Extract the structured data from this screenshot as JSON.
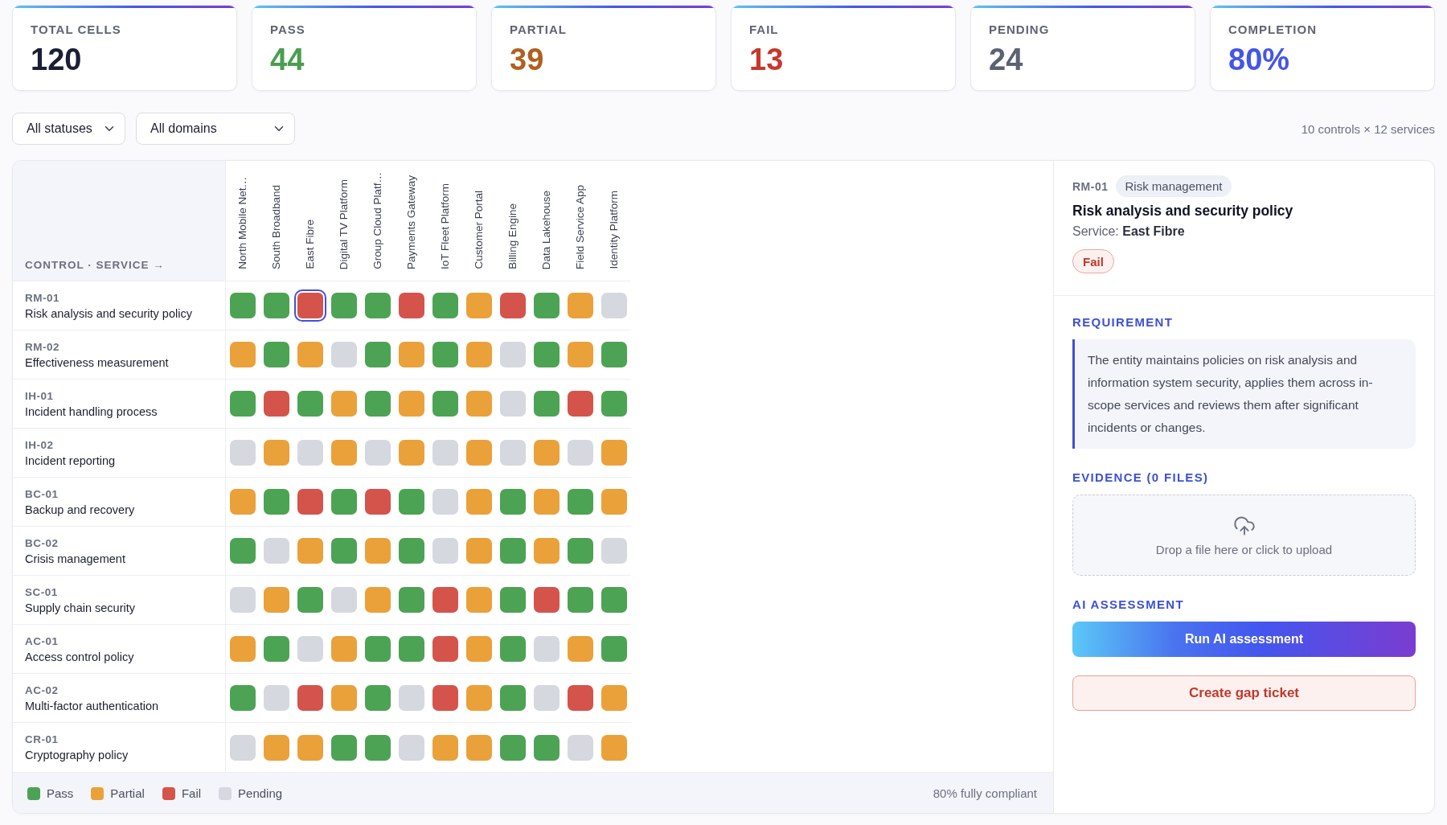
{
  "stats": [
    {
      "label": "TOTAL CELLS",
      "value": "120",
      "color": "#1b1e34"
    },
    {
      "label": "PASS",
      "value": "44",
      "color": "#4a9e4f"
    },
    {
      "label": "PARTIAL",
      "value": "39",
      "color": "#b0601f"
    },
    {
      "label": "FAIL",
      "value": "13",
      "color": "#c8372d"
    },
    {
      "label": "PENDING",
      "value": "24",
      "color": "#5d6271"
    },
    {
      "label": "COMPLETION",
      "value": "80%",
      "color": "#4456e6"
    }
  ],
  "filters": [
    {
      "value": "All statuses"
    },
    {
      "value": "All domains"
    }
  ],
  "summary": "10 controls × 12 services",
  "matrix": {
    "corner_label": "CONTROL · SERVICE →",
    "columns": [
      "North Mobile Net…",
      "South Broadband",
      "East Fibre",
      "Digital TV Platform",
      "Group Cloud Platf…",
      "Payments Gateway",
      "IoT Fleet Platform",
      "Customer Portal",
      "Billing Engine",
      "Data Lakehouse",
      "Field Service App",
      "Identity Platform"
    ],
    "rows": [
      {
        "code": "RM-01",
        "name": "Risk analysis and security policy",
        "cells": [
          {
            "color": "#4ca354",
            "selected": false
          },
          {
            "color": "#4ca354",
            "selected": false
          },
          {
            "color": "#d4544c",
            "selected": true
          },
          {
            "color": "#4ca354",
            "selected": false
          },
          {
            "color": "#4ca354",
            "selected": false
          },
          {
            "color": "#d4544c",
            "selected": false
          },
          {
            "color": "#4ca354",
            "selected": false
          },
          {
            "color": "#eaa13a",
            "selected": false
          },
          {
            "color": "#d4544c",
            "selected": false
          },
          {
            "color": "#4ca354",
            "selected": false
          },
          {
            "color": "#eaa13a",
            "selected": false
          },
          {
            "color": "#d6d8df",
            "selected": false
          }
        ]
      },
      {
        "code": "RM-02",
        "name": "Effectiveness measurement",
        "cells": [
          {
            "color": "#eaa13a",
            "selected": false
          },
          {
            "color": "#4ca354",
            "selected": false
          },
          {
            "color": "#eaa13a",
            "selected": false
          },
          {
            "color": "#d6d8df",
            "selected": false
          },
          {
            "color": "#4ca354",
            "selected": false
          },
          {
            "color": "#eaa13a",
            "selected": false
          },
          {
            "color": "#4ca354",
            "selected": false
          },
          {
            "color": "#eaa13a",
            "selected": false
          },
          {
            "color": "#d6d8df",
            "selected": false
          },
          {
            "color": "#4ca354",
            "selected": false
          },
          {
            "color": "#eaa13a",
            "selected": false
          },
          {
            "color": "#4ca354",
            "selected": false
          }
        ]
      },
      {
        "code": "IH-01",
        "name": "Incident handling process",
        "cells": [
          {
            "color": "#4ca354",
            "selected": false
          },
          {
            "color": "#d4544c",
            "selected": false
          },
          {
            "color": "#4ca354",
            "selected": false
          },
          {
            "color": "#eaa13a",
            "selected": false
          },
          {
            "color": "#4ca354",
            "selected": false
          },
          {
            "color": "#eaa13a",
            "selected": false
          },
          {
            "color": "#4ca354",
            "selected": false
          },
          {
            "color": "#eaa13a",
            "selected": false
          },
          {
            "color": "#d6d8df",
            "selected": false
          },
          {
            "color": "#4ca354",
            "selected": false
          },
          {
            "color": "#d4544c",
            "selected": false
          },
          {
            "color": "#4ca354",
            "selected": false
          }
        ]
      },
      {
        "code": "IH-02",
        "name": "Incident reporting",
        "cells": [
          {
            "color": "#d6d8df",
            "selected": false
          },
          {
            "color": "#eaa13a",
            "selected": false
          },
          {
            "color": "#d6d8df",
            "selected": false
          },
          {
            "color": "#eaa13a",
            "selected": false
          },
          {
            "color": "#d6d8df",
            "selected": false
          },
          {
            "color": "#eaa13a",
            "selected": false
          },
          {
            "color": "#d6d8df",
            "selected": false
          },
          {
            "color": "#eaa13a",
            "selected": false
          },
          {
            "color": "#d6d8df",
            "selected": false
          },
          {
            "color": "#eaa13a",
            "selected": false
          },
          {
            "color": "#d6d8df",
            "selected": false
          },
          {
            "color": "#eaa13a",
            "selected": false
          }
        ]
      },
      {
        "code": "BC-01",
        "name": "Backup and recovery",
        "cells": [
          {
            "color": "#eaa13a",
            "selected": false
          },
          {
            "color": "#4ca354",
            "selected": false
          },
          {
            "color": "#d4544c",
            "selected": false
          },
          {
            "color": "#4ca354",
            "selected": false
          },
          {
            "color": "#d4544c",
            "selected": false
          },
          {
            "color": "#4ca354",
            "selected": false
          },
          {
            "color": "#d6d8df",
            "selected": false
          },
          {
            "color": "#eaa13a",
            "selected": false
          },
          {
            "color": "#4ca354",
            "selected": false
          },
          {
            "color": "#eaa13a",
            "selected": false
          },
          {
            "color": "#4ca354",
            "selected": false
          },
          {
            "color": "#eaa13a",
            "selected": false
          }
        ]
      },
      {
        "code": "BC-02",
        "name": "Crisis management",
        "cells": [
          {
            "color": "#4ca354",
            "selected": false
          },
          {
            "color": "#d6d8df",
            "selected": false
          },
          {
            "color": "#eaa13a",
            "selected": false
          },
          {
            "color": "#4ca354",
            "selected": false
          },
          {
            "color": "#eaa13a",
            "selected": false
          },
          {
            "color": "#4ca354",
            "selected": false
          },
          {
            "color": "#d6d8df",
            "selected": false
          },
          {
            "color": "#eaa13a",
            "selected": false
          },
          {
            "color": "#4ca354",
            "selected": false
          },
          {
            "color": "#eaa13a",
            "selected": false
          },
          {
            "color": "#4ca354",
            "selected": false
          },
          {
            "color": "#d6d8df",
            "selected": false
          }
        ]
      },
      {
        "code": "SC-01",
        "name": "Supply chain security",
        "cells": [
          {
            "color": "#d6d8df",
            "selected": false
          },
          {
            "color": "#eaa13a",
            "selected": false
          },
          {
            "color": "#4ca354",
            "selected": false
          },
          {
            "color": "#d6d8df",
            "selected": false
          },
          {
            "color": "#eaa13a",
            "selected": false
          },
          {
            "color": "#4ca354",
            "selected": false
          },
          {
            "color": "#d4544c",
            "selected": false
          },
          {
            "color": "#eaa13a",
            "selected": false
          },
          {
            "color": "#4ca354",
            "selected": false
          },
          {
            "color": "#d4544c",
            "selected": false
          },
          {
            "color": "#4ca354",
            "selected": false
          },
          {
            "color": "#4ca354",
            "selected": false
          }
        ]
      },
      {
        "code": "AC-01",
        "name": "Access control policy",
        "cells": [
          {
            "color": "#eaa13a",
            "selected": false
          },
          {
            "color": "#4ca354",
            "selected": false
          },
          {
            "color": "#d6d8df",
            "selected": false
          },
          {
            "color": "#eaa13a",
            "selected": false
          },
          {
            "color": "#4ca354",
            "selected": false
          },
          {
            "color": "#4ca354",
            "selected": false
          },
          {
            "color": "#d4544c",
            "selected": false
          },
          {
            "color": "#eaa13a",
            "selected": false
          },
          {
            "color": "#4ca354",
            "selected": false
          },
          {
            "color": "#d6d8df",
            "selected": false
          },
          {
            "color": "#eaa13a",
            "selected": false
          },
          {
            "color": "#4ca354",
            "selected": false
          }
        ]
      },
      {
        "code": "AC-02",
        "name": "Multi-factor authentication",
        "cells": [
          {
            "color": "#4ca354",
            "selected": false
          },
          {
            "color": "#d6d8df",
            "selected": false
          },
          {
            "color": "#d4544c",
            "selected": false
          },
          {
            "color": "#eaa13a",
            "selected": false
          },
          {
            "color": "#4ca354",
            "selected": false
          },
          {
            "color": "#d6d8df",
            "selected": false
          },
          {
            "color": "#d4544c",
            "selected": false
          },
          {
            "color": "#eaa13a",
            "selected": false
          },
          {
            "color": "#4ca354",
            "selected": false
          },
          {
            "color": "#d6d8df",
            "selected": false
          },
          {
            "color": "#d4544c",
            "selected": false
          },
          {
            "color": "#eaa13a",
            "selected": false
          }
        ]
      },
      {
        "code": "CR-01",
        "name": "Cryptography policy",
        "cells": [
          {
            "color": "#d6d8df",
            "selected": false
          },
          {
            "color": "#eaa13a",
            "selected": false
          },
          {
            "color": "#eaa13a",
            "selected": false
          },
          {
            "color": "#4ca354",
            "selected": false
          },
          {
            "color": "#4ca354",
            "selected": false
          },
          {
            "color": "#d6d8df",
            "selected": false
          },
          {
            "color": "#eaa13a",
            "selected": false
          },
          {
            "color": "#eaa13a",
            "selected": false
          },
          {
            "color": "#4ca354",
            "selected": false
          },
          {
            "color": "#4ca354",
            "selected": false
          },
          {
            "color": "#d6d8df",
            "selected": false
          },
          {
            "color": "#eaa13a",
            "selected": false
          }
        ]
      }
    ]
  },
  "legend": {
    "items": [
      {
        "label": "Pass",
        "color": "#4ca354"
      },
      {
        "label": "Partial",
        "color": "#eaa13a"
      },
      {
        "label": "Fail",
        "color": "#d4544c"
      },
      {
        "label": "Pending",
        "color": "#d6d8df"
      }
    ],
    "summary": "80% fully compliant"
  },
  "detail": {
    "code": "RM-01",
    "domain": "Risk management",
    "title": "Risk analysis and security policy",
    "service": "Service: **East Fibre**",
    "status": {
      "label": "Fail",
      "kind": "fail"
    },
    "requirement": {
      "heading": "REQUIREMENT",
      "text": "The entity maintains policies on risk analysis and information system security, applies them across in-scope services and reviews them after significant incidents or changes."
    },
    "evidence": {
      "heading": "EVIDENCE (0 FILES)",
      "dropzone": "Drop a file here or click to upload"
    },
    "ai": {
      "heading": "AI ASSESSMENT",
      "button": "Run AI assessment"
    },
    "gap_button": "Create gap ticket"
  }
}
